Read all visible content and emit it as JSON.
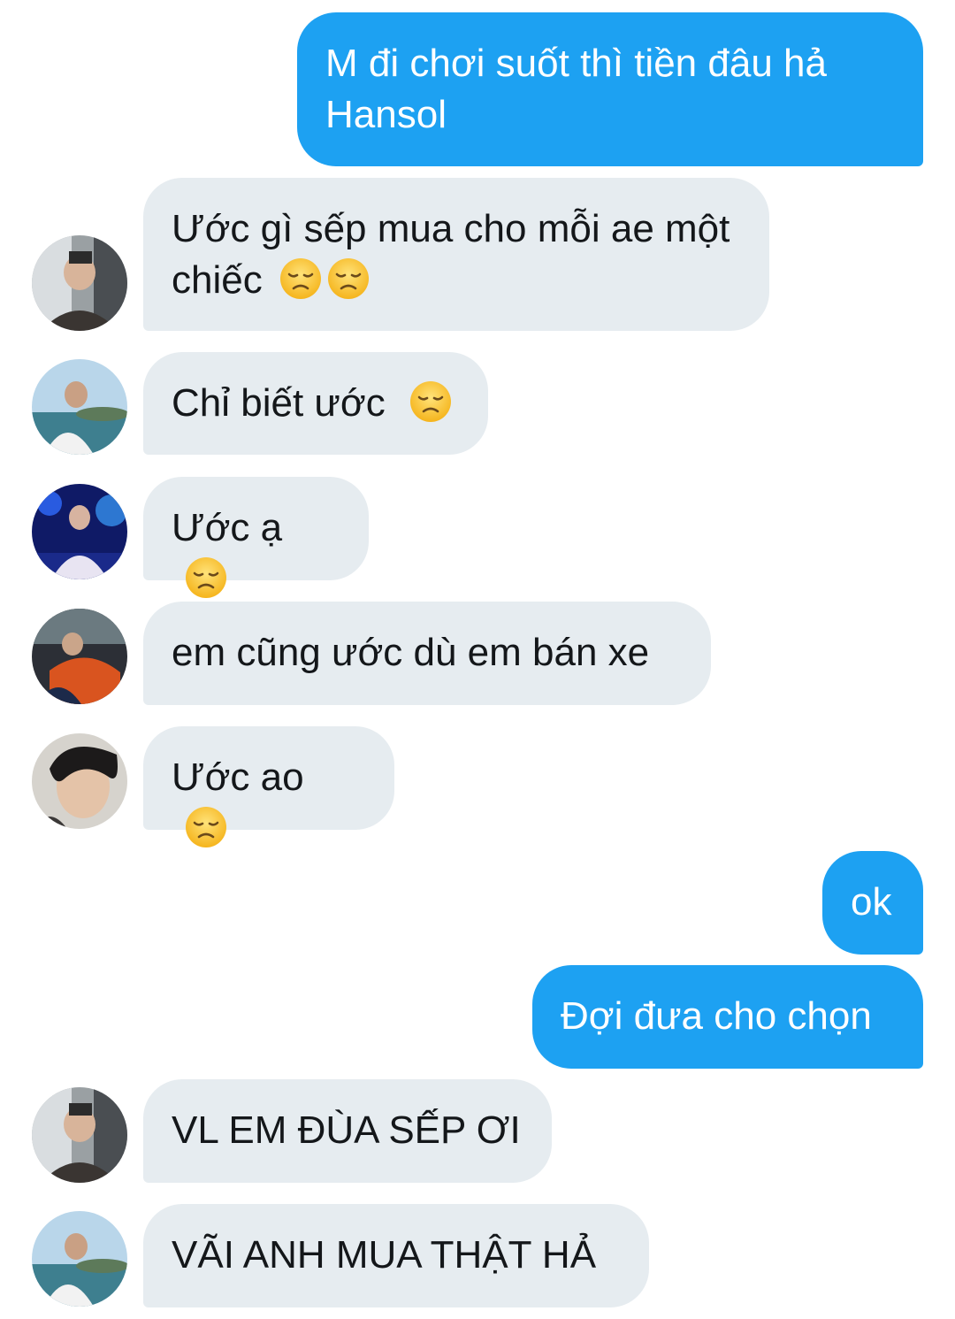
{
  "colors": {
    "sent_bubble": "#1da1f2",
    "received_bubble": "#e6ecf0",
    "sent_text": "#ffffff",
    "received_text": "#14171a"
  },
  "messages": [
    {
      "direction": "sent",
      "text": "M đi chơi suốt thì tiền đâu hả Hansol"
    },
    {
      "direction": "received",
      "sender_avatar": "avatar-1",
      "text": "Ước gì sếp mua cho mỗi ae một chiếc",
      "emoji": [
        "disappointed-face-icon",
        "disappointed-face-icon"
      ]
    },
    {
      "direction": "received",
      "sender_avatar": "avatar-2",
      "text": "Chỉ biết ước",
      "emoji": [
        "disappointed-face-icon"
      ]
    },
    {
      "direction": "received",
      "sender_avatar": "avatar-3",
      "text": "Ước ạ",
      "emoji": [
        "disappointed-face-icon"
      ]
    },
    {
      "direction": "received",
      "sender_avatar": "avatar-4",
      "text": "em cũng ước dù em bán xe"
    },
    {
      "direction": "received",
      "sender_avatar": "avatar-5",
      "text": "Ước ao",
      "emoji": [
        "disappointed-face-icon"
      ]
    },
    {
      "direction": "sent",
      "text": "ok"
    },
    {
      "direction": "sent",
      "text": "Đợi đưa cho chọn"
    },
    {
      "direction": "received",
      "sender_avatar": "avatar-1",
      "text": "VL EM ĐÙA SẾP ƠI"
    },
    {
      "direction": "received",
      "sender_avatar": "avatar-2",
      "text": "VÃI ANH MUA THẬT HẢ"
    }
  ]
}
